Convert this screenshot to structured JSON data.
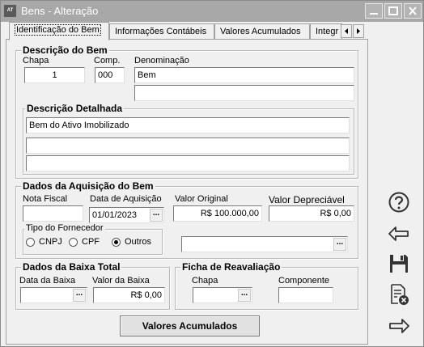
{
  "window": {
    "title": "Bens - Alteração",
    "app_icon": "AT"
  },
  "tabs": [
    {
      "label": "Identificação do Bem",
      "active": true
    },
    {
      "label": "Informações Contábeis"
    },
    {
      "label": "Valores Acumulados"
    },
    {
      "label": "Integr"
    }
  ],
  "descricao": {
    "title": "Descrição  do Bem",
    "chapa_label": "Chapa",
    "chapa": "1",
    "comp_label": "Comp.",
    "comp": "000",
    "denominacao_label": "Denominação",
    "denominacao": "Bem",
    "denominacao2": "",
    "detalhada_title": "Descrição Detalhada",
    "detalhada": [
      "Bem do Ativo Imobilizado",
      "",
      "",
      ""
    ]
  },
  "aquisicao": {
    "title": "Dados da Aquisição do Bem",
    "nota_label": "Nota Fiscal",
    "nota": "",
    "data_label": "Data de Aquisição",
    "data": "01/01/2023",
    "valor_original_label": "Valor Original",
    "valor_original": "R$ 100.000,00",
    "valor_depreciavel_label": "Valor Depreciável",
    "valor_depreciavel": "R$ 0,00",
    "tipo_label": "Tipo do Fornecedor",
    "tipos": [
      "CNPJ",
      "CPF",
      "Outros"
    ],
    "tipo_selected": "Outros",
    "fornecedor": ""
  },
  "baixa": {
    "title": "Dados da Baixa Total",
    "data_label": "Data da Baixa",
    "data": "",
    "valor_label": "Valor da Baixa",
    "valor": "R$ 0,00"
  },
  "reavaliacao": {
    "title": "Ficha de Reavaliação",
    "chapa_label": "Chapa",
    "chapa": "",
    "componente_label": "Componente",
    "componente": ""
  },
  "buttons": {
    "valores_acumulados": "Valores Acumulados",
    "dots": "..."
  },
  "sidebar_icons": [
    "help-icon",
    "back-arrow-icon",
    "save-icon",
    "delete-document-icon",
    "forward-arrow-icon"
  ]
}
